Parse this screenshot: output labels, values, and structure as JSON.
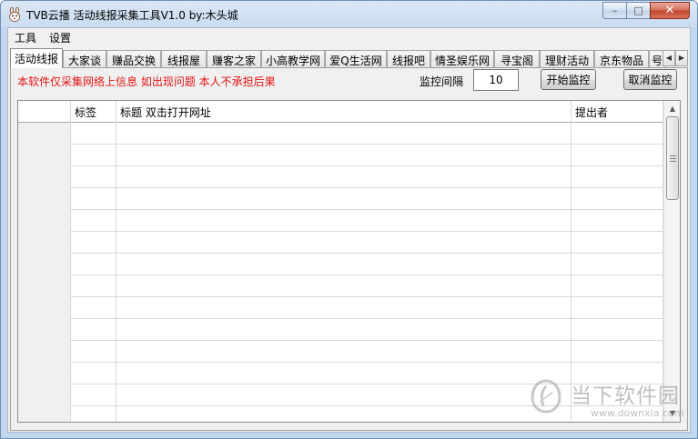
{
  "window": {
    "title": "TVB云播 活动线报采集工具V1.0  by:木头城",
    "minimize": "–",
    "maximize": "□",
    "close": "✕"
  },
  "menu": {
    "items": [
      "工具",
      "设置"
    ]
  },
  "tabs": {
    "items": [
      "活动线报",
      "大家谈",
      "赚品交换",
      "线报屋",
      "赚客之家",
      "小高教学网",
      "爱Q生活网",
      "线报吧",
      "情圣娱乐网",
      "寻宝阁",
      "理财活动",
      "京东物品",
      "号"
    ],
    "active_index": 0,
    "scroll_left": "◀",
    "scroll_right": "▶"
  },
  "toolbar": {
    "notice": "本软件仅采集网络上信息  如出现问题  本人不承担后果",
    "interval_label": "监控间隔",
    "interval_value": "10",
    "start_label": "开始监控",
    "cancel_label": "取消监控"
  },
  "grid": {
    "columns": [
      "",
      "标签",
      "标题 双击打开网址",
      "提出者"
    ],
    "rows": [
      [
        "",
        "",
        "",
        ""
      ],
      [
        "",
        "",
        "",
        ""
      ],
      [
        "",
        "",
        "",
        ""
      ],
      [
        "",
        "",
        "",
        ""
      ],
      [
        "",
        "",
        "",
        ""
      ],
      [
        "",
        "",
        "",
        ""
      ],
      [
        "",
        "",
        "",
        ""
      ],
      [
        "",
        "",
        "",
        ""
      ],
      [
        "",
        "",
        "",
        ""
      ],
      [
        "",
        "",
        "",
        ""
      ],
      [
        "",
        "",
        "",
        ""
      ],
      [
        "",
        "",
        "",
        ""
      ],
      [
        "",
        "",
        "",
        ""
      ],
      [
        "",
        "",
        "",
        ""
      ]
    ],
    "scroll_up": "▲",
    "scroll_down": "▼"
  },
  "watermark": {
    "name": "当下软件园",
    "url": "www.downxia.com"
  },
  "colors": {
    "notice_text": "#e21414",
    "title_bar": "#c9dcf1"
  }
}
